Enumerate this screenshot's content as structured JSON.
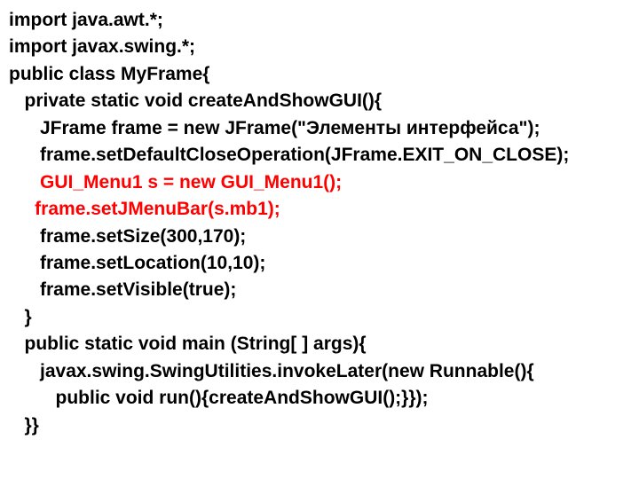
{
  "code": {
    "l1": "import java.awt.*;",
    "l2": "import javax.swing.*;",
    "l3": "public class MyFrame{",
    "l4": "   private static void createAndShowGUI(){",
    "l5": "      JFrame frame = new JFrame(\"Элементы интерфейса\");",
    "l6": "      frame.setDefaultCloseOperation(JFrame.EXIT_ON_CLOSE);",
    "l7": "      GUI_Menu1 s = new GUI_Menu1();",
    "l8": "     frame.setJMenuBar(s.mb1);",
    "l9": "      frame.setSize(300,170);",
    "l10": "      frame.setLocation(10,10);",
    "l11": "      frame.setVisible(true);",
    "l12": "   }",
    "l13": "   public static void main (String[ ] args){",
    "l14": "      javax.swing.SwingUtilities.invokeLater(new Runnable(){",
    "l15": "         public void run(){createAndShowGUI();}});",
    "l16": "   }}"
  }
}
